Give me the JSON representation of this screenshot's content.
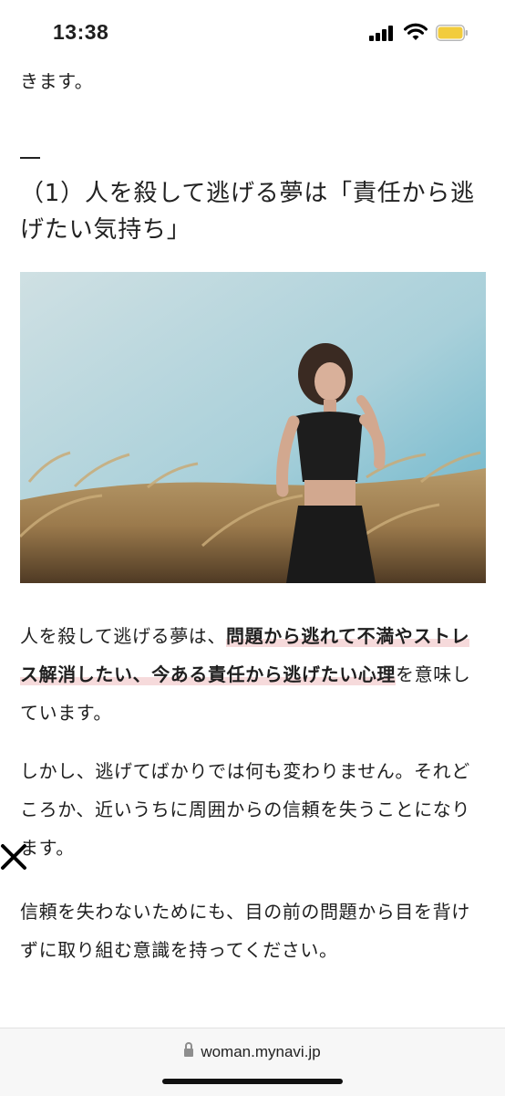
{
  "status_bar": {
    "time": "13:38",
    "signal_icon": "cellular-signal-icon",
    "wifi_icon": "wifi-icon",
    "battery_icon": "battery-icon",
    "battery_color": "#f2cc3c"
  },
  "article": {
    "continued_text": "きます。",
    "heading": "（1）人を殺して逃げる夢は「責任から逃げたい気持ち」",
    "paragraph1": {
      "pre": "人を殺して逃げる夢は、",
      "highlight": "問題から逃れて不満やストレス解消したい、今ある責任から逃げたい心理",
      "post": "を意味しています。"
    },
    "paragraph2": "しかし、逃げてばかりでは何も変わりません。それどころか、近いうちに周囲からの信頼を失うことになります。",
    "paragraph3": "信頼を失わないためにも、目の前の問題から目を背けずに取り組む意識を持ってください。",
    "highlight_color": "#f6dadb"
  },
  "overlay": {
    "close_icon": "close-icon"
  },
  "browser": {
    "lock_icon": "lock-icon",
    "url": "woman.mynavi.jp"
  }
}
